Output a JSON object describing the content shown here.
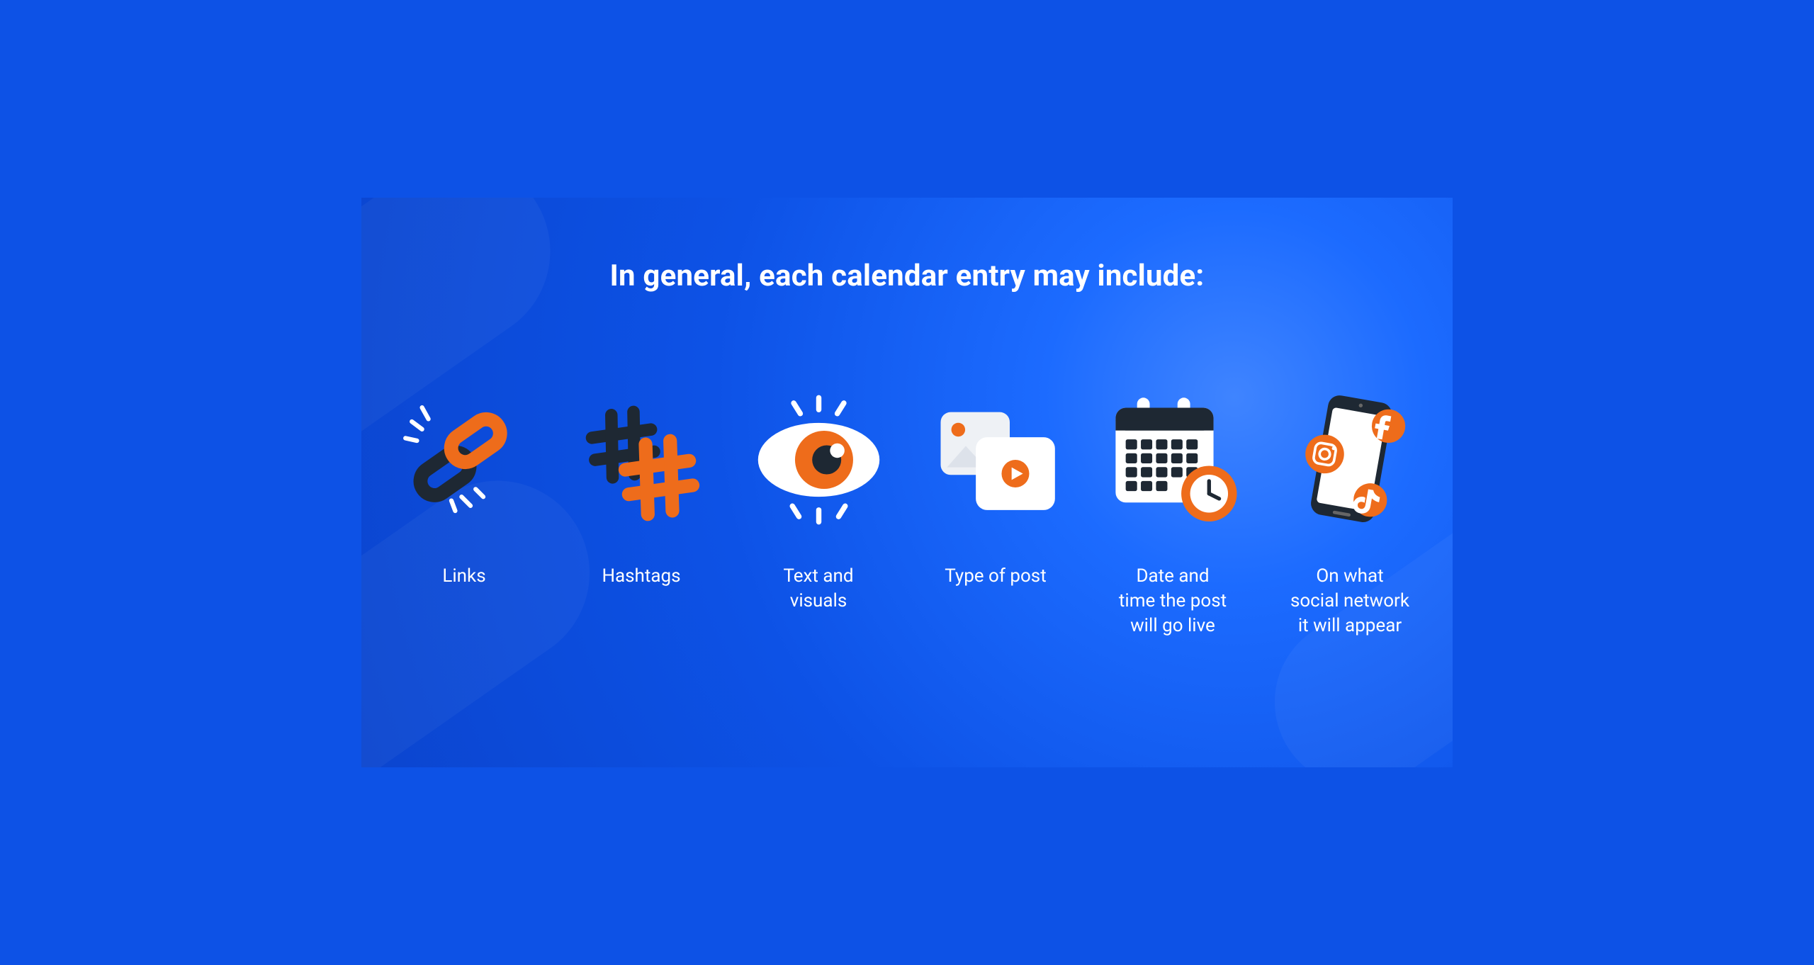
{
  "colors": {
    "orange": "#ee6c1b",
    "dark": "#1e2833",
    "white": "#ffffff",
    "offwhite": "#f2f4f7",
    "bg_from": "#3f84ff",
    "bg_to": "#0b45cf"
  },
  "title": "In general, each calendar entry may include:",
  "items": [
    {
      "icon": "link-icon",
      "label": "Links"
    },
    {
      "icon": "hashtags-icon",
      "label": "Hashtags"
    },
    {
      "icon": "eye-icon",
      "label": "Text and\nvisuals"
    },
    {
      "icon": "media-icon",
      "label": "Type of post"
    },
    {
      "icon": "calendar-clock-icon",
      "label": "Date and\ntime the post\nwill go live"
    },
    {
      "icon": "phone-social-icon",
      "label": "On what\nsocial network\nit will appear"
    }
  ]
}
